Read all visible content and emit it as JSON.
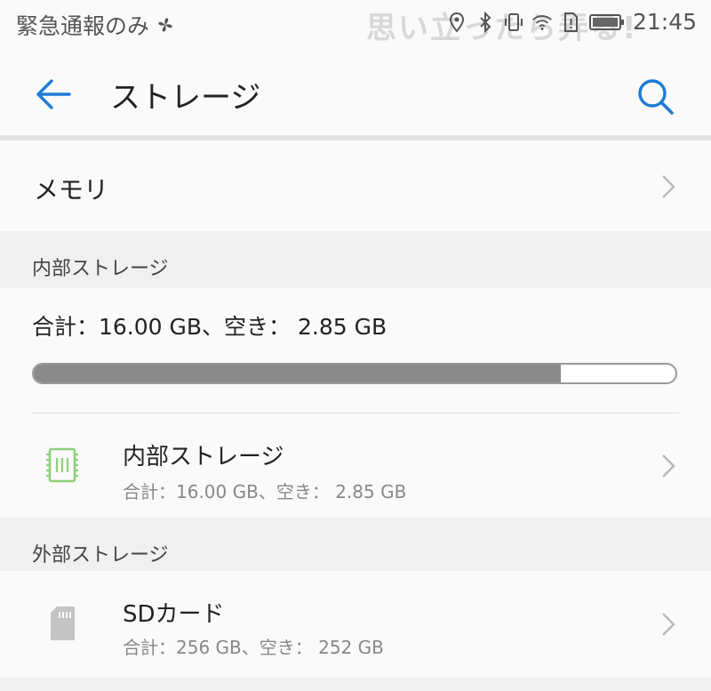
{
  "status_bar": {
    "carrier_text": "緊急通報のみ",
    "watermark": "思い立ったら弄る!",
    "time": "21:45",
    "icons": [
      "fan-icon",
      "location-icon",
      "bluetooth-icon",
      "vibrate-icon",
      "wifi-icon",
      "sim-alert-icon",
      "battery-icon"
    ]
  },
  "toolbar": {
    "title": "ストレージ",
    "back_icon": "arrow-left-icon",
    "search_icon": "search-icon",
    "accent_color": "#1e7bd6"
  },
  "memory": {
    "label": "メモリ"
  },
  "internal_section": {
    "header": "内部ストレージ",
    "summary": "合計：16.00 GB、空き： 2.85 GB",
    "used_fraction": 0.822,
    "item": {
      "title": "内部ストレージ",
      "subtitle": "合計：16.00 GB、空き： 2.85 GB",
      "icon": "chip-icon",
      "icon_color": "#8fd07a"
    }
  },
  "external_section": {
    "header": "外部ストレージ",
    "item": {
      "title": "SDカード",
      "subtitle": "合計：256 GB、空き： 252 GB",
      "icon": "sd-card-icon",
      "icon_color": "#c4c4c4"
    }
  }
}
